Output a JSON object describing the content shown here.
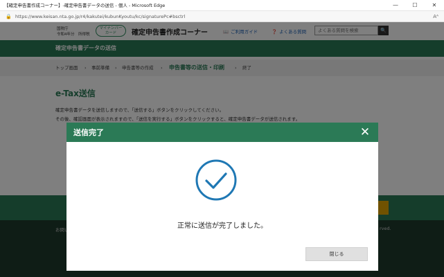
{
  "window": {
    "title": "【確定申告書作成コーナー】-確定申告書データの送信 - 個人 - Microsoft Edge",
    "url": "https://www.keisan.nta.go.jp/r4/kakutei/kubunKyoutu/kc/signaturePc#bsctrl",
    "minimize": "—",
    "maximize": "☐",
    "close": "✕"
  },
  "header": {
    "org_line1": "国税庁",
    "org_line2": "令和4年分　所得税",
    "mynumber_line1": "マイナンバー",
    "mynumber_line2": "カード",
    "site_title": "確定申告書作成コーナー",
    "guide_link": "ご利用ガイド",
    "faq_link": "よくある質問",
    "search_placeholder": "よくある質問を検索",
    "search_icon": "🔍"
  },
  "section_bar": "確定申告書データの送信",
  "breadcrumbs": [
    "トップ画面",
    "事前準備",
    "申告書等の作成",
    "申告書等の送信・印刷",
    "終了"
  ],
  "breadcrumb_sep": "›",
  "content": {
    "title": "e-Tax送信",
    "line1": "確定申告書データを送信しますので、「送信する」ボタンをクリックしてください。",
    "line2": "その後、確認画面が表示されますので、「送信を実行する」ボタンをクリックすると、確定申告書データが送信されます。"
  },
  "footer": {
    "left": "お問い",
    "right": "rved."
  },
  "modal": {
    "title": "送信完了",
    "close_x": "✕",
    "message": "正常に送信が完了しました。",
    "close_button": "閉じる"
  },
  "colors": {
    "brand_green": "#2b7a56",
    "check_blue": "#1f78b4"
  }
}
